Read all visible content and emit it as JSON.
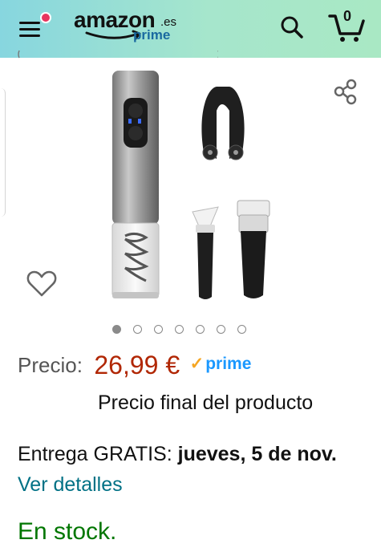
{
  "header": {
    "brand": "amazon",
    "brand_tld": ".es",
    "brand_sub": "prime",
    "cart_count": "0",
    "icons": [
      "hamburger-menu-icon",
      "search-icon",
      "cart-icon"
    ]
  },
  "product": {
    "image_alt": "Electric wine opener set",
    "carousel_total": 7,
    "carousel_active": 1,
    "icons": [
      "share-icon",
      "heart-icon"
    ]
  },
  "price": {
    "label": "Precio:",
    "value": "26,99 €",
    "prime": "prime"
  },
  "final_price_note": "Precio final del producto",
  "delivery": {
    "prefix": "Entrega GRATIS:",
    "date": "jueves, 5 de nov.",
    "link": "Ver detalles"
  },
  "stock": "En stock.",
  "colors": {
    "price": "#b12704",
    "link": "#007185",
    "stock": "#007600",
    "prime": "#1a98ff",
    "header_start": "#87d6df",
    "header_end": "#a9e8c4",
    "notification_dot": "#e7355e"
  }
}
